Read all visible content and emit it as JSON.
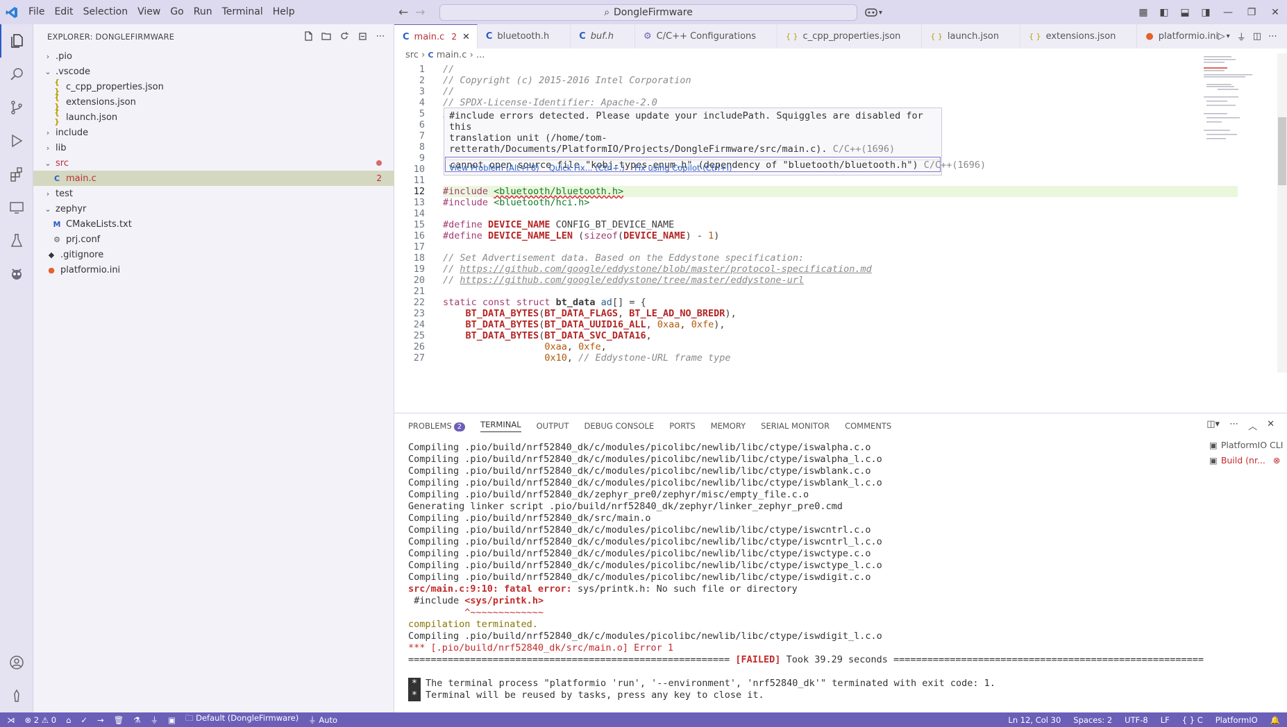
{
  "window": {
    "title": "DongleFirmware"
  },
  "menu": [
    "File",
    "Edit",
    "Selection",
    "View",
    "Go",
    "Run",
    "Terminal",
    "Help"
  ],
  "sidebar": {
    "title": "EXPLORER: DONGLEFIRMWARE",
    "tree": [
      {
        "label": ".pio",
        "kind": "folder",
        "expanded": false,
        "indent": 0
      },
      {
        "label": ".vscode",
        "kind": "folder",
        "expanded": true,
        "indent": 0
      },
      {
        "label": "c_cpp_properties.json",
        "kind": "json",
        "indent": 1
      },
      {
        "label": "extensions.json",
        "kind": "json",
        "indent": 1
      },
      {
        "label": "launch.json",
        "kind": "json",
        "indent": 1
      },
      {
        "label": "include",
        "kind": "folder",
        "expanded": false,
        "indent": 0
      },
      {
        "label": "lib",
        "kind": "folder",
        "expanded": false,
        "indent": 0
      },
      {
        "label": "src",
        "kind": "folder",
        "expanded": true,
        "indent": 0,
        "error": true
      },
      {
        "label": "main.c",
        "kind": "c",
        "indent": 1,
        "selected": true,
        "errors": "2"
      },
      {
        "label": "test",
        "kind": "folder",
        "expanded": false,
        "indent": 0
      },
      {
        "label": "zephyr",
        "kind": "folder",
        "expanded": true,
        "indent": 0
      },
      {
        "label": "CMakeLists.txt",
        "kind": "cmake",
        "indent": 1
      },
      {
        "label": "prj.conf",
        "kind": "gear",
        "indent": 1
      },
      {
        "label": ".gitignore",
        "kind": "git",
        "indent": 0
      },
      {
        "label": "platformio.ini",
        "kind": "pio",
        "indent": 0
      }
    ]
  },
  "tabs": [
    {
      "label": "main.c",
      "icon": "C",
      "active": true,
      "errors": "2",
      "close": "✕"
    },
    {
      "label": "bluetooth.h",
      "icon": "C"
    },
    {
      "label": "buf.h",
      "icon": "C",
      "italic": true
    },
    {
      "label": "C/C++ Configurations",
      "icon": "gear"
    },
    {
      "label": "c_cpp_properties.json",
      "icon": "{}"
    },
    {
      "label": "launch.json",
      "icon": "{}"
    },
    {
      "label": "extensions.json",
      "icon": "{}"
    },
    {
      "label": "platformio.ini",
      "icon": "pio"
    }
  ],
  "breadcrumb": {
    "folder": "src",
    "file": "main.c",
    "rest": "..."
  },
  "code_lines": [
    {
      "n": "1",
      "html": "<span class='cm'>//</span>"
    },
    {
      "n": "2",
      "html": "<span class='cm'>// Copyright (c) 2015-2016 Intel Corporation</span>"
    },
    {
      "n": "3",
      "html": "<span class='cm'>//</span>"
    },
    {
      "n": "4",
      "html": "<span class='cm'>// SPDX-License-Identifier: Apache-2.0</span>"
    },
    {
      "n": "5",
      "html": "<span class='cm'>//</span>"
    },
    {
      "n": "6",
      "html": ""
    },
    {
      "n": "7",
      "html": ""
    },
    {
      "n": "8",
      "html": ""
    },
    {
      "n": "9",
      "html": ""
    },
    {
      "n": "10",
      "html": ""
    },
    {
      "n": "11",
      "html": ""
    },
    {
      "n": "12",
      "html": "<span class='kw'>#include</span> <span class='str' style='text-decoration:underline wavy #d12'>&lt;bluetooth/bluetooth.h&gt;</span>"
    },
    {
      "n": "13",
      "html": "<span class='kw'>#include</span> <span class='str'>&lt;bluetooth/hci.h&gt;</span>"
    },
    {
      "n": "14",
      "html": ""
    },
    {
      "n": "15",
      "html": "<span class='kw'>#define</span> <span class='mac'>DEVICE_NAME</span> CONFIG_BT_DEVICE_NAME"
    },
    {
      "n": "16",
      "html": "<span class='kw'>#define</span> <span class='mac'>DEVICE_NAME_LEN</span> (<span class='kw'>sizeof</span>(<span class='mac'>DEVICE_NAME</span>) - <span class='num'>1</span>)"
    },
    {
      "n": "17",
      "html": ""
    },
    {
      "n": "18",
      "html": "<span class='cm'>// Set Advertisement data. Based on the Eddystone specification:</span>"
    },
    {
      "n": "19",
      "html": "<span class='cm'>// </span><span class='lnk'>https://github.com/google/eddystone/blob/master/protocol-specification.md</span>"
    },
    {
      "n": "20",
      "html": "<span class='cm'>// </span><span class='lnk'>https://github.com/google/eddystone/tree/master/eddystone-url</span>"
    },
    {
      "n": "21",
      "html": ""
    },
    {
      "n": "22",
      "html": "<span class='kw'>static</span> <span class='kw'>const</span> <span class='kw'>struct</span> <b>bt_data</b> <span class='fn'>ad</span>[] = {"
    },
    {
      "n": "23",
      "html": "    <span class='mac'>BT_DATA_BYTES</span>(<span class='mac'>BT_DATA_FLAGS</span>, <span class='mac'>BT_LE_AD_NO_BREDR</span>),"
    },
    {
      "n": "24",
      "html": "    <span class='mac'>BT_DATA_BYTES</span>(<span class='mac'>BT_DATA_UUID16_ALL</span>, <span class='num'>0xaa</span>, <span class='num'>0xfe</span>),"
    },
    {
      "n": "25",
      "html": "    <span class='mac'>BT_DATA_BYTES</span>(<span class='mac'>BT_DATA_SVC_DATA16</span>,"
    },
    {
      "n": "26",
      "html": "                  <span class='num'>0xaa</span>, <span class='num'>0xfe</span>,"
    },
    {
      "n": "27",
      "html": "                  <span class='num'>0x10</span>, <span class='cm'>// Eddystone-URL frame type</span>"
    }
  ],
  "hover": {
    "msg1": "#include errors detected. Please update your includePath. Squiggles are disabled for this",
    "msg2": "translation unit (/home/tom-",
    "msg3": "retterath/Documents/PlatformIO/Projects/DongleFirmware/src/main.c).",
    "msg3_code": "C/C++(1696)",
    "msg4": "cannot open source file \"kobj-types-enum.h\" (dependency of \"bluetooth/bluetooth.h\")",
    "msg4_code": "C/C++(1696)",
    "act1": "View Problem (Alt+F8)",
    "act2": "Quick Fix... (Ctrl+.)",
    "act3": "Fix using Copilot (Ctrl+I)"
  },
  "panel": {
    "tabs": [
      "PROBLEMS",
      "TERMINAL",
      "OUTPUT",
      "DEBUG CONSOLE",
      "PORTS",
      "MEMORY",
      "SERIAL MONITOR",
      "COMMENTS"
    ],
    "problems_count": "2",
    "active_tab": "TERMINAL",
    "terminals": [
      "PlatformIO CLI",
      "Build (nr..."
    ]
  },
  "terminal_lines": [
    {
      "t": "Compiling .pio/build/nrf52840_dk/c/modules/picolibc/newlib/libc/ctype/iswalpha.c.o"
    },
    {
      "t": "Compiling .pio/build/nrf52840_dk/c/modules/picolibc/newlib/libc/ctype/iswalpha_l.c.o"
    },
    {
      "t": "Compiling .pio/build/nrf52840_dk/c/modules/picolibc/newlib/libc/ctype/iswblank.c.o"
    },
    {
      "t": "Compiling .pio/build/nrf52840_dk/c/modules/picolibc/newlib/libc/ctype/iswblank_l.c.o"
    },
    {
      "t": "Compiling .pio/build/nrf52840_dk/zephyr_pre0/zephyr/misc/empty_file.c.o"
    },
    {
      "t": "Generating linker script .pio/build/nrf52840_dk/zephyr/linker_zephyr_pre0.cmd"
    },
    {
      "t": "Compiling .pio/build/nrf52840_dk/src/main.o"
    },
    {
      "t": "Compiling .pio/build/nrf52840_dk/c/modules/picolibc/newlib/libc/ctype/iswcntrl.c.o"
    },
    {
      "t": "Compiling .pio/build/nrf52840_dk/c/modules/picolibc/newlib/libc/ctype/iswcntrl_l.c.o"
    },
    {
      "t": "Compiling .pio/build/nrf52840_dk/c/modules/picolibc/newlib/libc/ctype/iswctype.c.o"
    },
    {
      "t": "Compiling .pio/build/nrf52840_dk/c/modules/picolibc/newlib/libc/ctype/iswctype_l.c.o"
    },
    {
      "t": "Compiling .pio/build/nrf52840_dk/c/modules/picolibc/newlib/libc/ctype/iswdigit.c.o"
    },
    {
      "t": "src/main.c:9:10: fatal error:",
      "rest": " sys/printk.h: No such file or directory",
      "cls": "ferr"
    },
    {
      "t": " #include ",
      "rest": "<sys/printk.h>",
      "cls2": "ferr"
    },
    {
      "t": "          ^~~~~~~~~~~~~~",
      "cls": "red"
    },
    {
      "t": "compilation terminated.",
      "cls": "olive"
    },
    {
      "t": "Compiling .pio/build/nrf52840_dk/c/modules/picolibc/newlib/libc/ctype/iswdigit_l.c.o"
    },
    {
      "t": "*** [.pio/build/nrf52840_dk/src/main.o] Error 1",
      "cls": "red"
    },
    {
      "t": "========================================================= ",
      "mid": "[FAILED]",
      "rest": " Took 39.29 seconds ======================================================="
    },
    {
      "t": ""
    },
    {
      "star": "*",
      "t": "The terminal process \"platformio 'run', '--environment', 'nrf52840_dk'\" terminated with exit code: 1."
    },
    {
      "star": "*",
      "t": "Terminal will be reused by tasks, press any key to close it."
    }
  ],
  "status": {
    "errors": "2",
    "warnings": "0",
    "env": "Default (DongleFirmware)",
    "auto": "Auto",
    "position": "Ln 12, Col 30",
    "spaces": "Spaces: 2",
    "encoding": "UTF-8",
    "eol": "LF",
    "lang_braces": "{ }",
    "lang": "C",
    "platformio": "PlatformIO"
  },
  "colors": {
    "accent": "#6b5fb8",
    "error": "#c2252b",
    "titlebar": "#dddaef"
  }
}
